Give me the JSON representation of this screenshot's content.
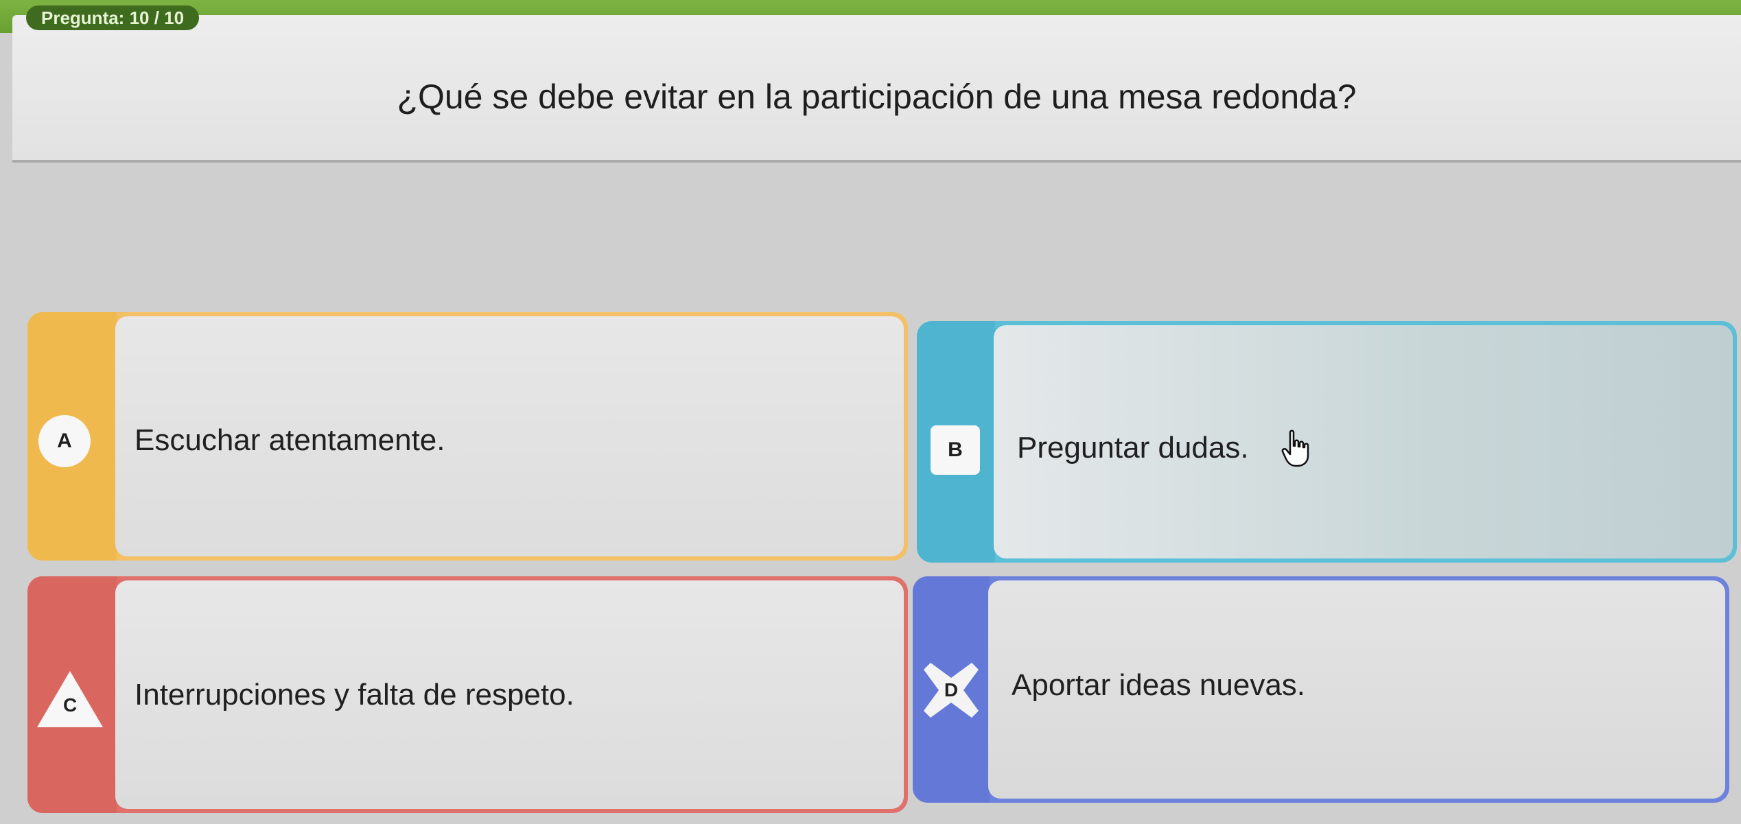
{
  "header": {
    "counter": "Pregunta: 10 / 10"
  },
  "question": {
    "text": "¿Qué se debe evitar en la participación de una mesa redonda?"
  },
  "options": [
    {
      "letter": "A",
      "text": "Escuchar atentamente.",
      "color": "#f0b94e",
      "shape": "circle"
    },
    {
      "letter": "B",
      "text": "Preguntar dudas.",
      "color": "#4fb4d0",
      "shape": "square"
    },
    {
      "letter": "C",
      "text": "Interrupciones y falta de respeto.",
      "color": "#d96760",
      "shape": "triangle"
    },
    {
      "letter": "D",
      "text": "Aportar ideas nuevas.",
      "color": "#6478d8",
      "shape": "cross"
    }
  ],
  "cursor": {
    "icon": "hand-pointer-icon"
  }
}
